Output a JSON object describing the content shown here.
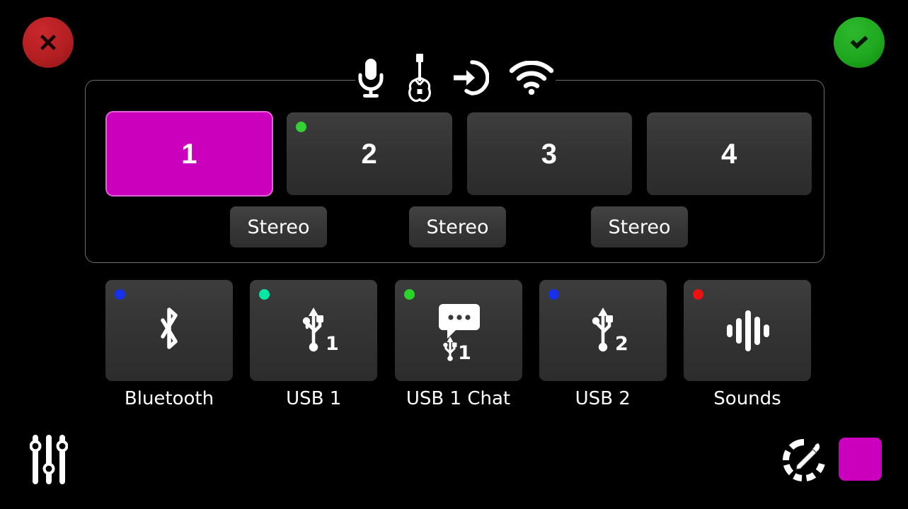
{
  "screen": {
    "title": "Input Source Routing",
    "background": "#000000",
    "accent_color": "#cb00bd"
  },
  "actions": {
    "cancel": {
      "label": "Cancel",
      "icon": "close-icon",
      "color": "#b41f22"
    },
    "confirm": {
      "label": "Confirm",
      "icon": "check-icon",
      "color": "#20a820"
    }
  },
  "source_types": [
    {
      "id": "mic",
      "icon": "microphone-icon",
      "label": "Microphone"
    },
    {
      "id": "guitar",
      "icon": "guitar-icon",
      "label": "Guitar"
    },
    {
      "id": "line-in",
      "icon": "line-in-icon",
      "label": "Line In"
    },
    {
      "id": "wireless",
      "icon": "wifi-icon",
      "label": "Wireless"
    }
  ],
  "channels": [
    {
      "number": "1",
      "selected": true,
      "indicator": null
    },
    {
      "number": "2",
      "selected": false,
      "indicator": "#35d035"
    },
    {
      "number": "3",
      "selected": false,
      "indicator": null
    },
    {
      "number": "4",
      "selected": false,
      "indicator": null
    }
  ],
  "stereo_links": [
    {
      "label": "Stereo",
      "pair": "1-2"
    },
    {
      "label": "Stereo",
      "pair": "2-3"
    },
    {
      "label": "Stereo",
      "pair": "3-4"
    }
  ],
  "source_tiles": [
    {
      "id": "bluetooth",
      "label": "Bluetooth",
      "icon": "bluetooth-icon",
      "indicator": "#1631e8",
      "badge": ""
    },
    {
      "id": "usb1",
      "label": "USB 1",
      "icon": "usb-icon",
      "indicator": "#00e6a4",
      "badge": "1"
    },
    {
      "id": "usb1chat",
      "label": "USB 1 Chat",
      "icon": "usb-chat-icon",
      "indicator": "#2ad52a",
      "badge": "1"
    },
    {
      "id": "usb2",
      "label": "USB 2",
      "icon": "usb-icon",
      "indicator": "#1631e8",
      "badge": "2"
    },
    {
      "id": "sounds",
      "label": "Sounds",
      "icon": "waveform-icon",
      "indicator": "#ee1111",
      "badge": ""
    }
  ],
  "footer": {
    "mixer": {
      "icon": "mixer-faders-icon",
      "label": "Mixer"
    },
    "color_picker": {
      "icon": "color-picker-icon",
      "label": "Color Picker"
    },
    "color_swatch": {
      "label": "Channel Color",
      "color": "#cb00bd"
    }
  }
}
